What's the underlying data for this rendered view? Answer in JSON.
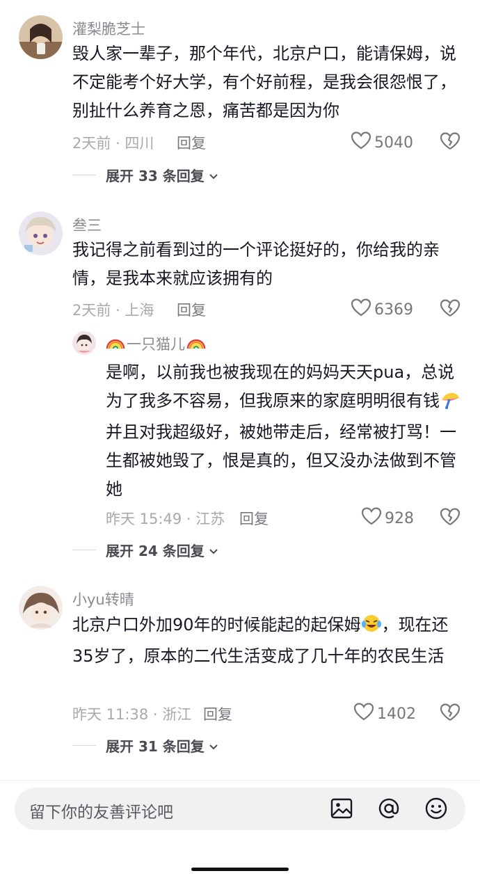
{
  "comments": [
    {
      "author": "灌梨脆芝士",
      "text": "毁人家一辈子，那个年代，北京户口，能请保姆，说不定能考个好大学，有个好前程，是我会很怨恨了，别扯什么养育之恩，痛苦都是因为你",
      "meta": "2天前 · 四川",
      "reply_label": "回复",
      "likes": "5040",
      "expand_label": "展开 33 条回复"
    },
    {
      "author": "叁三",
      "text": "我记得之前看到过的一个评论挺好的，你给我的亲情，是我本来就应该拥有的",
      "meta": "2天前 · 上海",
      "reply_label": "回复",
      "likes": "6369",
      "expand_label": "展开 24 条回复",
      "reply": {
        "author_name": "一只猫儿",
        "text_before": "是啊，以前我也被我现在的妈妈天天pua，总说为了我多不容易，但我原来的家庭明明很有钱",
        "text_after": "并且对我超级好，被她带走后，经常被打骂！一生都被她毁了，恨是真的，但又没办法做到不管她",
        "meta": "昨天 15:49 · 江苏",
        "reply_label": "回复",
        "likes": "928"
      }
    },
    {
      "author": "小yu转晴",
      "text_before": "北京户口外加90年的时候能起的起保姆",
      "text_after": "，现在还35岁了，原本的二代生活变成了几十年的农民生活",
      "meta": "昨天 11:38 · 浙江",
      "reply_label": "回复",
      "likes": "1402",
      "expand_label": "展开 31 条回复"
    }
  ],
  "input": {
    "placeholder": "留下你的友善评论吧"
  },
  "icons": {
    "like": "heart-outline-icon",
    "dislike": "broken-heart-icon",
    "expand": "chevron-down-icon",
    "image": "image-icon",
    "mention": "at-icon",
    "emoji": "smiley-icon"
  },
  "colors": {
    "text": "#161823",
    "secondary": "#8a8b91",
    "meta": "#a8a9ad",
    "input_bg": "#f1f1f2"
  }
}
